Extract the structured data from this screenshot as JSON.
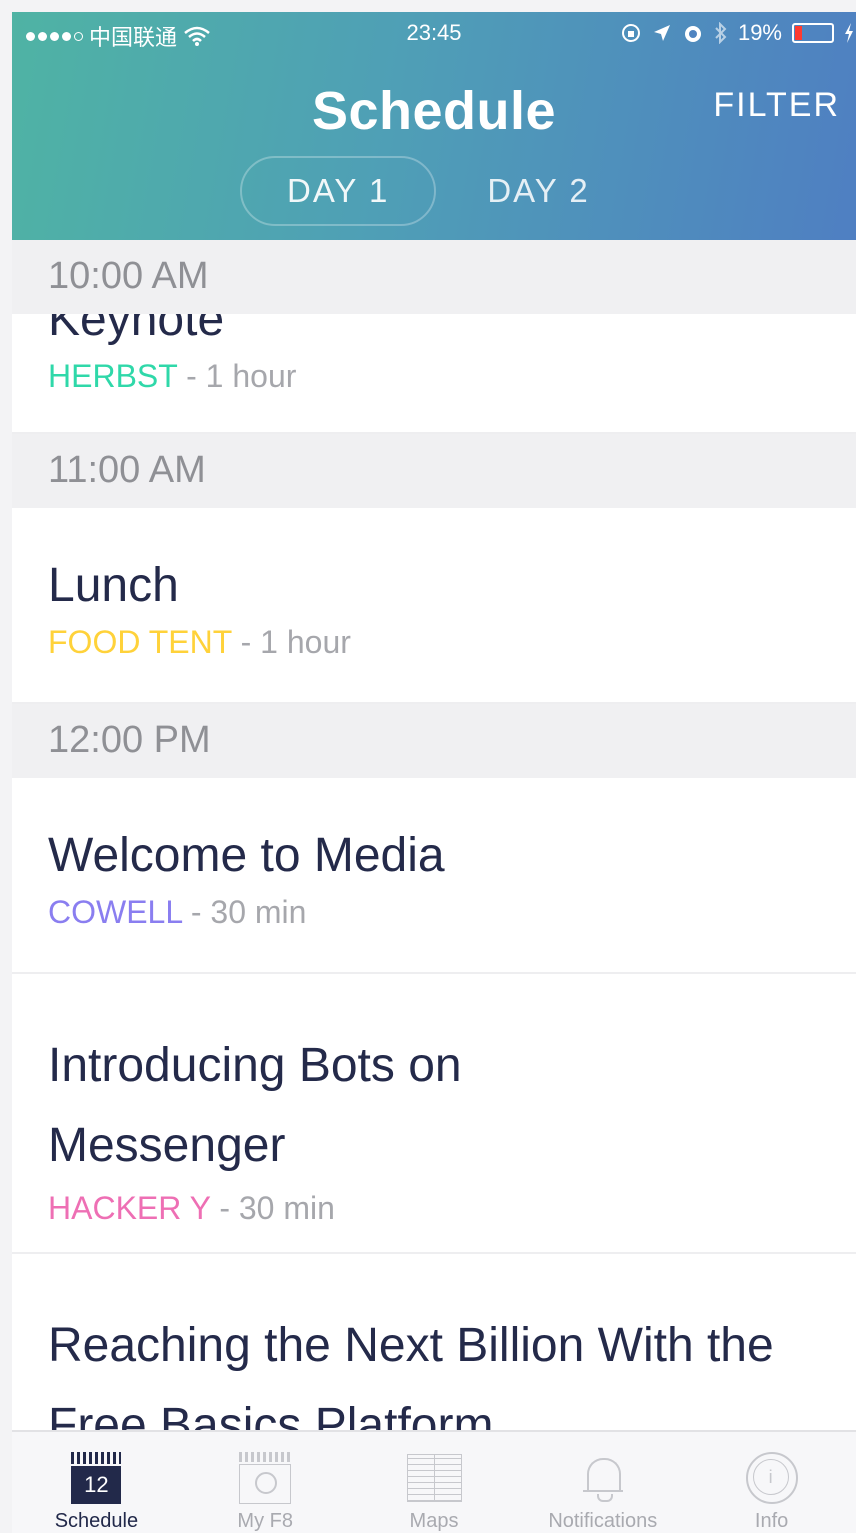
{
  "status_bar": {
    "carrier": "中国联通",
    "time": "23:45",
    "battery": "19%",
    "battery_level": 0.19
  },
  "header": {
    "title": "Schedule",
    "filter_label": "FILTER",
    "tabs": [
      {
        "label": "DAY 1",
        "active": true
      },
      {
        "label": "DAY 2",
        "active": false
      }
    ]
  },
  "sections": [
    {
      "time": "10:00 AM",
      "sessions": [
        {
          "title": "Keynote",
          "location": "HERBST",
          "location_color": "#2fd8a9",
          "duration": " - 1 hour"
        }
      ]
    },
    {
      "time": "11:00 AM",
      "sessions": [
        {
          "title": "Lunch",
          "location": "FOOD TENT",
          "location_color": "#ffd23a",
          "duration": " - 1 hour"
        }
      ]
    },
    {
      "time": "12:00 PM",
      "sessions": [
        {
          "title": "Welcome to Media",
          "location": "COWELL",
          "location_color": "#8a7ef0",
          "duration": " - 30 min"
        },
        {
          "title": "Introducing Bots on Messenger",
          "location": "HACKER Y",
          "location_color": "#ee6fb4",
          "duration": " - 30 min"
        },
        {
          "title": "Reaching the Next Billion With the Free Basics Platform",
          "location": "",
          "location_color": "#8a7ef0",
          "duration": ""
        }
      ]
    }
  ],
  "tab_bar": {
    "calendar_day": "12",
    "items": [
      {
        "label": "Schedule",
        "icon": "calendar-icon",
        "active": true
      },
      {
        "label": "My F8",
        "icon": "my-f8-icon",
        "active": false
      },
      {
        "label": "Maps",
        "icon": "map-icon",
        "active": false
      },
      {
        "label": "Notifications",
        "icon": "bell-icon",
        "active": false
      },
      {
        "label": "Info",
        "icon": "info-icon",
        "active": false
      }
    ]
  }
}
